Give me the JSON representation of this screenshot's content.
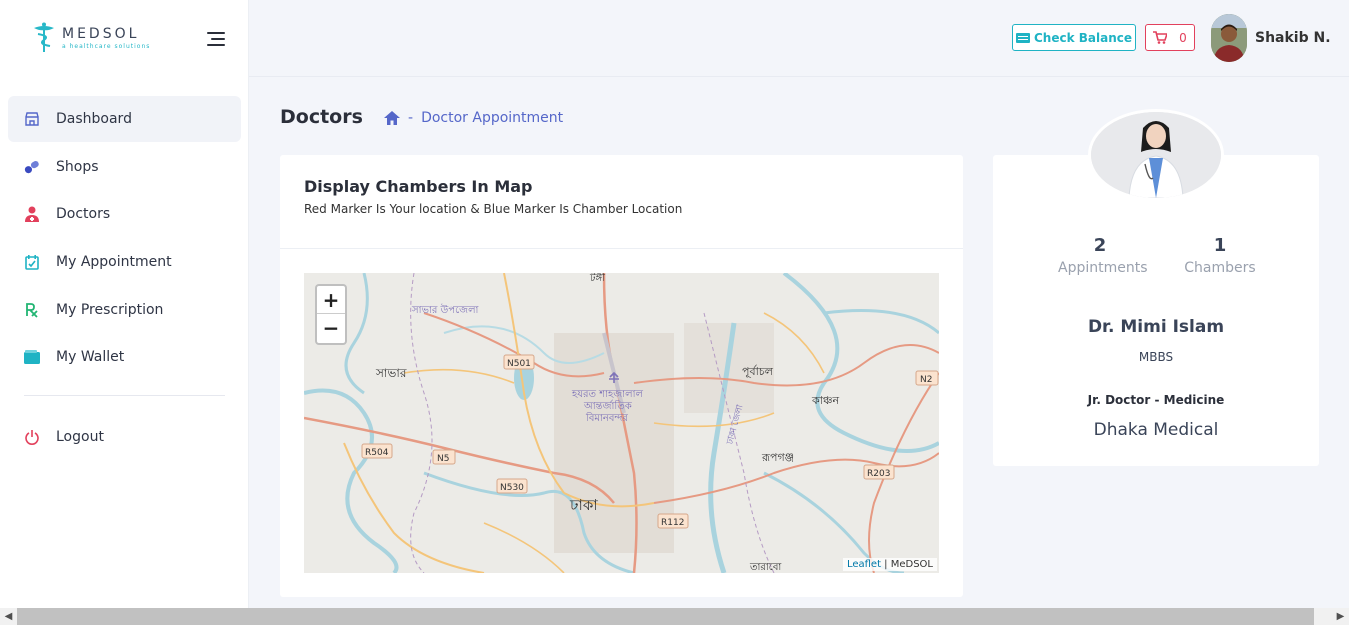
{
  "brand": {
    "name": "MEDSOL",
    "tagline": "a healthcare solutions"
  },
  "sidebar": {
    "items": [
      {
        "label": "Dashboard",
        "icon": "store-icon",
        "active": true
      },
      {
        "label": "Shops",
        "icon": "pills-icon"
      },
      {
        "label": "Doctors",
        "icon": "doctor-icon"
      },
      {
        "label": "My Appointment",
        "icon": "calendar-check-icon"
      },
      {
        "label": "My Prescription",
        "icon": "prescription-icon"
      },
      {
        "label": "My Wallet",
        "icon": "wallet-icon"
      }
    ],
    "logout": {
      "label": "Logout",
      "icon": "power-icon"
    }
  },
  "topbar": {
    "check_balance": "Check Balance",
    "cart_count": "0",
    "user_name": "Shakib N."
  },
  "page": {
    "title": "Doctors",
    "breadcrumb": "Doctor Appointment"
  },
  "map_card": {
    "title": "Display Chambers In Map",
    "subtitle": "Red Marker Is Your location & Blue Marker Is Chamber Location",
    "zoom_in": "+",
    "zoom_out": "−",
    "attribution_link": "Leaflet",
    "attribution_text": " | MeDSOL",
    "labels": {
      "tongi": "টঙ্গী",
      "savar_upazila": "সাভার উপজেলা",
      "savar": "সাভার",
      "n501": "N501",
      "purbachal": "পূর্বাচল",
      "n2": "N2",
      "airport1": "হযরত শাহজালাল",
      "airport2": "আন্তর্জাতিক",
      "airport3": "বিমানবন্দর",
      "kanchan": "কাঞ্চন",
      "dhaka_jela": "ঢাকা জেলা",
      "r504": "R504",
      "n5": "N5",
      "rupganj": "রূপগঞ্জ",
      "r203": "R203",
      "n530": "N530",
      "dhaka": "ঢাকা",
      "r112": "R112",
      "tarabo": "তারাবো"
    }
  },
  "doctor": {
    "appointments": "2",
    "appointments_label": "Appintments",
    "chambers": "1",
    "chambers_label": "Chambers",
    "name": "Dr. Mimi Islam",
    "degree": "MBBS",
    "role": "Jr. Doctor - Medicine",
    "hospital": "Dhaka Medical"
  },
  "colors": {
    "accent": "#1fb3c4",
    "danger": "#e2405c",
    "link": "#5567c9"
  }
}
